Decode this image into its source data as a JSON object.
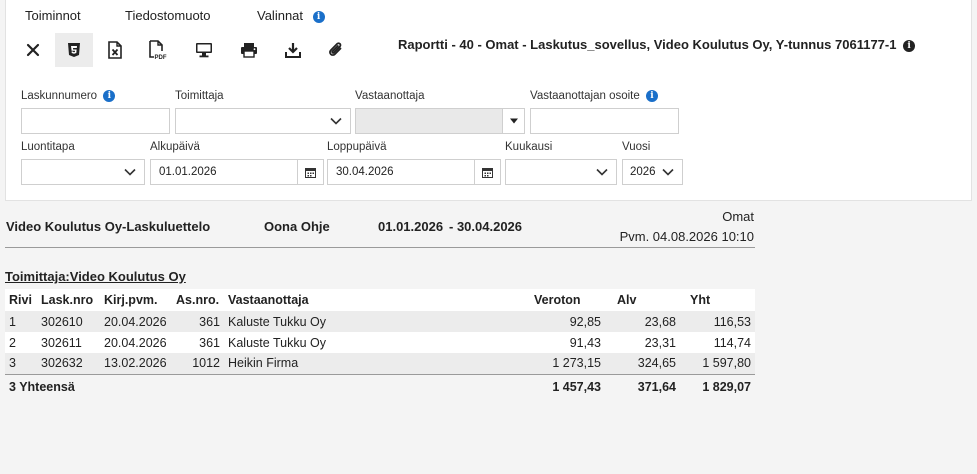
{
  "menu": {
    "actions": "Toiminnot",
    "file_format": "Tiedostomuoto",
    "options": "Valinnat"
  },
  "toolbar": {
    "buttons": [
      "close-icon",
      "html-file-icon",
      "excel-file-icon",
      "pdf-file-icon",
      "monitor-icon",
      "print-icon",
      "download-icon",
      "attachment-icon"
    ]
  },
  "report_title": "Raportti - 40 - Omat - Laskutus_sovellus, Video Koulutus Oy, Y-tunnus 7061177-1",
  "filters": {
    "invoice_number_label": "Laskunnumero",
    "invoice_number_value": "",
    "supplier_label": "Toimittaja",
    "supplier_value": "",
    "recipient_label": "Vastaanottaja",
    "recipient_value": "",
    "recipient_address_label": "Vastaanottajan osoite",
    "recipient_address_value": "",
    "creation_method_label": "Luontitapa",
    "creation_method_value": "",
    "start_date_label": "Alkupäivä",
    "start_date_value": "01.01.2026",
    "end_date_label": "Loppupäivä",
    "end_date_value": "30.04.2026",
    "month_label": "Kuukausi",
    "month_value": "",
    "year_label": "Vuosi",
    "year_value": "2026"
  },
  "report_header": {
    "list_title": "Video Koulutus Oy-Laskuluettelo",
    "user": "Oona Ohje",
    "period_start": "01.01.2026",
    "period_end": "- 30.04.2026",
    "scope": "Omat",
    "printed": "Pvm. 04.08.2026 10:10"
  },
  "supplier_heading": "Toimittaja:Video Koulutus Oy",
  "table": {
    "columns": [
      "Rivi",
      "Lask.nro",
      "Kirj.pvm.",
      "As.nro.",
      "Vastaanottaja",
      "Veroton",
      "Alv",
      "Yht"
    ],
    "rows": [
      [
        "1",
        "302610",
        "20.04.2026",
        "361",
        "Kaluste Tukku Oy",
        "92,85",
        "23,68",
        "116,53"
      ],
      [
        "2",
        "302611",
        "20.04.2026",
        "361",
        "Kaluste Tukku Oy",
        "91,43",
        "23,31",
        "114,74"
      ],
      [
        "3",
        "302632",
        "13.02.2026",
        "1012",
        "Heikin Firma",
        "1 273,15",
        "324,65",
        "1 597,80"
      ]
    ],
    "total": {
      "label": "3 Yhteensä",
      "veroton": "1 457,43",
      "alv": "371,64",
      "yht": "1 829,07"
    }
  },
  "colors": {
    "info_blue": "#1a6fc9",
    "stripe": "#ececec",
    "panel_bg": "#ffffff",
    "page_bg": "#f4f4f4"
  }
}
